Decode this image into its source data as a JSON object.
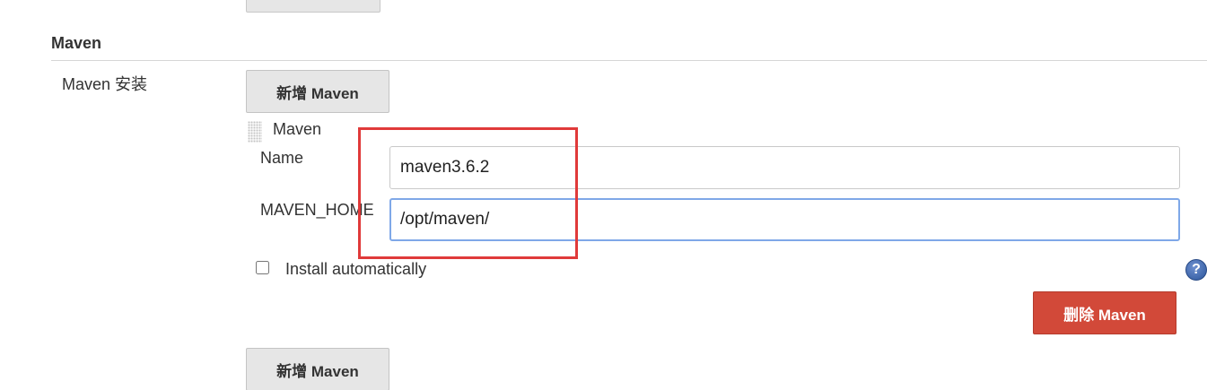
{
  "section": {
    "title": "Maven",
    "row_label": "Maven 安装"
  },
  "buttons": {
    "add_top_label": "新增 Maven",
    "add_bottom_label": "新增 Maven",
    "delete_label": "删除 Maven"
  },
  "installation": {
    "header": "Maven",
    "name_label": "Name",
    "name_value": "maven3.6.2",
    "home_label": "MAVEN_HOME",
    "home_value": "/opt/maven/",
    "install_auto_label": "Install automatically",
    "install_auto_checked": false
  },
  "icons": {
    "help": "help-icon",
    "drag": "drag-handle-icon"
  },
  "colors": {
    "delete_button": "#d24939",
    "highlight_box": "#e03a3a",
    "focused_input_border": "#7fa8e8"
  }
}
